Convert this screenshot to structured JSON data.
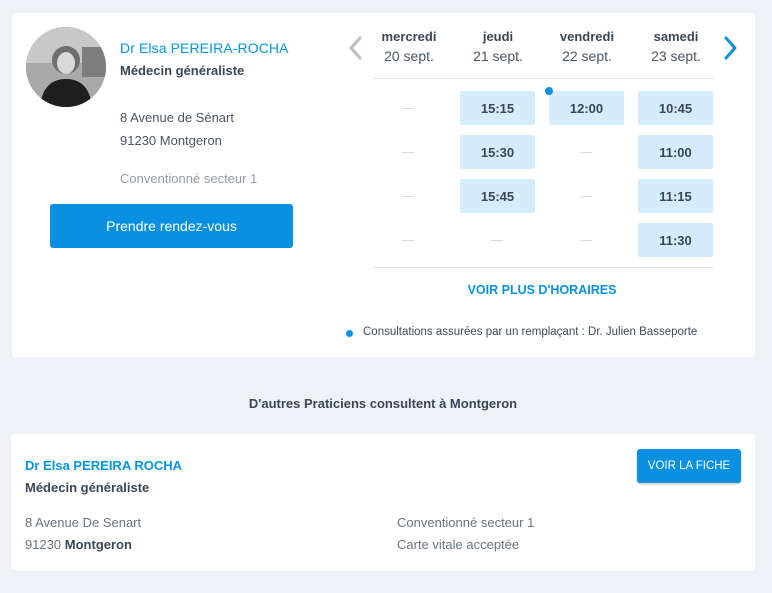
{
  "doctor": {
    "name": "Dr Elsa PEREIRA-ROCHA",
    "specialty": "Médecin généraliste",
    "address_line1": "8 Avenue de Sénart",
    "address_line2": "91230 Montgeron",
    "sector": "Conventionné secteur 1",
    "book_label": "Prendre rendez-vous"
  },
  "calendar": {
    "days": [
      {
        "name": "mercredi",
        "date": "20 sept.",
        "slots": []
      },
      {
        "name": "jeudi",
        "date": "21 sept.",
        "slots": [
          "15:15",
          "15:30",
          "15:45"
        ]
      },
      {
        "name": "vendredi",
        "date": "22 sept.",
        "slots": [
          "12:00"
        ],
        "marked": true
      },
      {
        "name": "samedi",
        "date": "23 sept.",
        "slots": [
          "10:45",
          "11:00",
          "11:15",
          "11:30"
        ]
      }
    ],
    "more_label": "VOIR PLUS D'HORAIRES",
    "note": "Consultations assurées par un remplaçant : Dr. Julien Basseporte",
    "accent": "#0a90e0",
    "slot_bg": "#d4ecfb"
  },
  "others": {
    "title": "D'autres Praticiens consultent à Montgeron",
    "card": {
      "name": "Dr Elsa PEREIRA ROCHA",
      "specialty": "Médecin généraliste",
      "address_line1": "8 Avenue De Senart",
      "postcode": "91230",
      "city": "Montgeron",
      "sector": "Conventionné secteur 1",
      "vitale": "Carte vitale acceptée",
      "button_label": "VOIR LA FICHE"
    }
  },
  "icons": {
    "prev": "chevron-left-icon",
    "next": "chevron-right-icon",
    "dot": "replacement-dot-icon"
  }
}
